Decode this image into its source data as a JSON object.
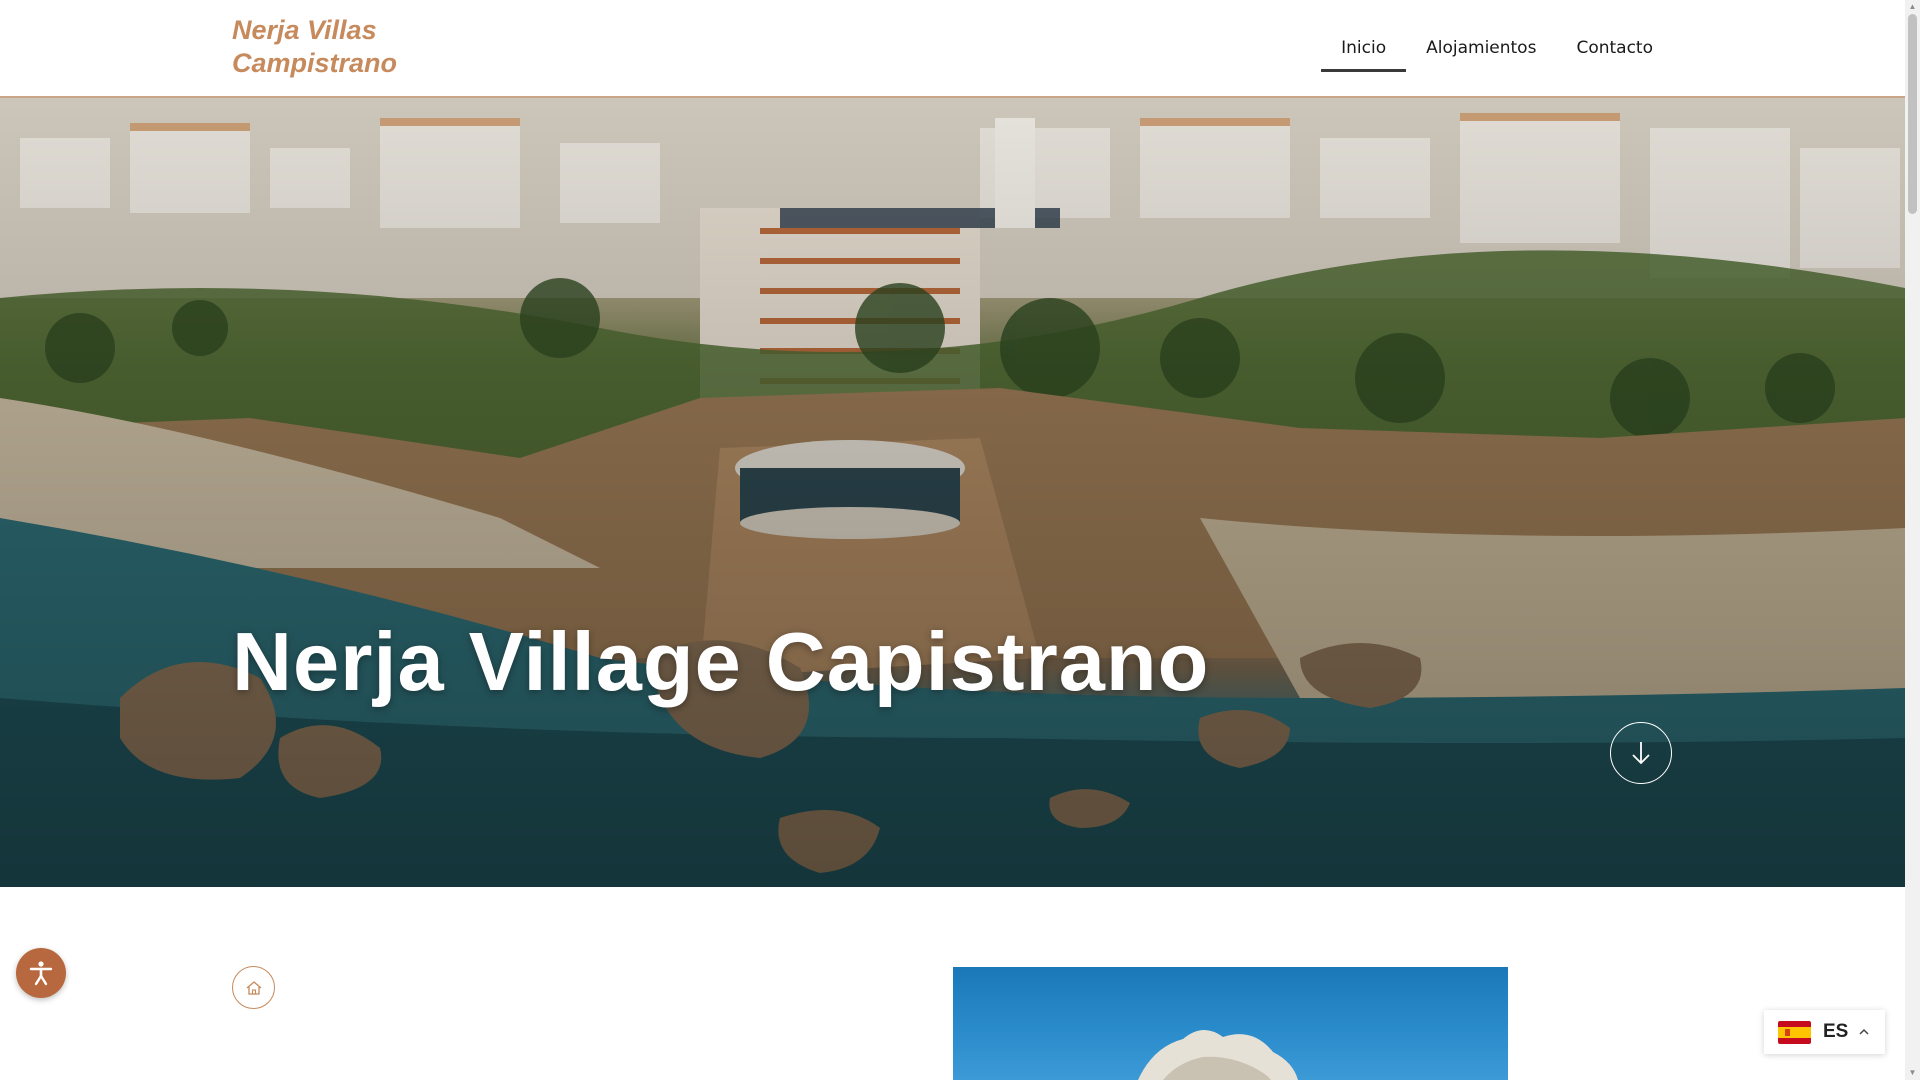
{
  "header": {
    "logo_line1": "Nerja Villas",
    "logo_line2": "Campistrano",
    "nav": [
      {
        "label": "Inicio",
        "active": true
      },
      {
        "label": "Alojamientos",
        "active": false
      },
      {
        "label": "Contacto",
        "active": false
      }
    ]
  },
  "hero": {
    "title": "Nerja Village Capistrano",
    "scroll_icon": "arrow-down-icon"
  },
  "content": {
    "home_icon": "home-icon"
  },
  "accessibility": {
    "icon": "accessibility-icon"
  },
  "language": {
    "code": "ES",
    "flag_icon": "spain-flag-icon",
    "caret_icon": "chevron-up-icon"
  },
  "colors": {
    "brand": "#c68a5c",
    "accessibility_bg": "#b8683e",
    "text": "#1a1a1a"
  }
}
